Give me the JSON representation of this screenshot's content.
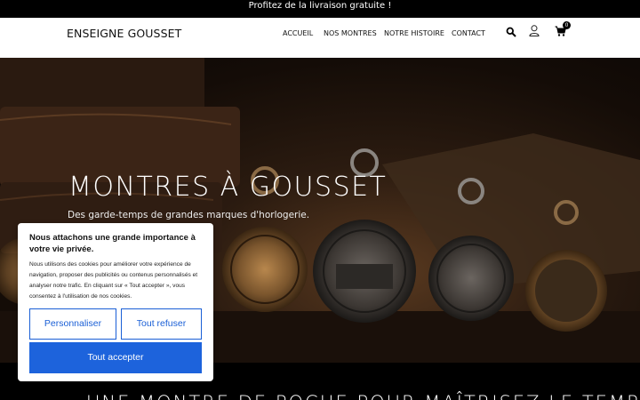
{
  "announcement": "Profitez de la livraison gratuite !",
  "header": {
    "brand": "ENSEIGNE GOUSSET",
    "nav": [
      "ACCUEIL",
      "NOS MONTRES",
      "NOTRE HISTOIRE",
      "CONTACT"
    ],
    "icons": [
      "search-icon",
      "user-icon",
      "cart-icon"
    ],
    "cart_count": "0"
  },
  "hero": {
    "title": "MONTRES À GOUSSET",
    "subtitle": "Des garde-temps de grandes marques d'horlogerie."
  },
  "section": {
    "title": "UNE MONTRE DE POCHE POUR MAÎTRISEZ LE TEMPS"
  },
  "cookie": {
    "title": "Nous attachons une grande importance à votre vie privée.",
    "text": "Nous utilisons des cookies pour améliorer votre expérience de navigation, proposer des publicités ou contenus personnalisés et analyser notre trafic. En cliquant sur « Tout accepter », vous consentez à l'utilisation de nos cookies.",
    "customize": "Personnaliser",
    "refuse": "Tout refuser",
    "accept": "Tout accepter",
    "accent": "#1d63dc"
  }
}
